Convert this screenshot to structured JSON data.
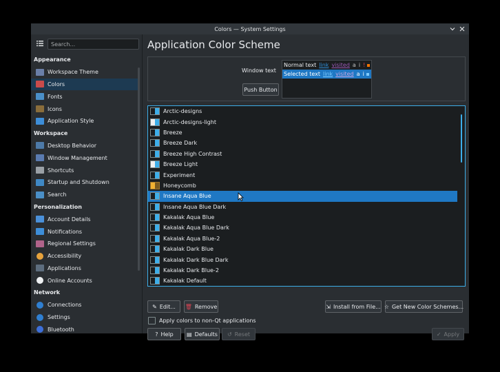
{
  "window": {
    "title": "Colors — System Settings"
  },
  "sidebar": {
    "search_placeholder": "Search...",
    "sections": [
      {
        "header": "Appearance",
        "items": [
          {
            "label": "Workspace Theme",
            "icon": "workspace-theme-icon",
            "color": "#6a7fa8"
          },
          {
            "label": "Colors",
            "icon": "colors-icon",
            "color": "#c94b4b",
            "active": true
          },
          {
            "label": "Fonts",
            "icon": "fonts-icon",
            "color": "#4a8fc7"
          },
          {
            "label": "Icons",
            "icon": "icons-icon",
            "color": "#8a6d3b"
          },
          {
            "label": "Application Style",
            "icon": "app-style-icon",
            "color": "#3d8ed9"
          }
        ]
      },
      {
        "header": "Workspace",
        "items": [
          {
            "label": "Desktop Behavior",
            "icon": "desktop-behavior-icon",
            "color": "#4d7aa8"
          },
          {
            "label": "Window Management",
            "icon": "window-management-icon",
            "color": "#5a7bb0"
          },
          {
            "label": "Shortcuts",
            "icon": "shortcuts-icon",
            "color": "#9aa0a6"
          },
          {
            "label": "Startup and Shutdown",
            "icon": "startup-icon",
            "color": "#3f88c5"
          },
          {
            "label": "Search",
            "icon": "search-icon",
            "color": "#4a8fc7"
          }
        ]
      },
      {
        "header": "Personalization",
        "items": [
          {
            "label": "Account Details",
            "icon": "account-icon",
            "color": "#4a90d9"
          },
          {
            "label": "Notifications",
            "icon": "notifications-icon",
            "color": "#3d8ed9"
          },
          {
            "label": "Regional Settings",
            "icon": "regional-icon",
            "color": "#b0638a"
          },
          {
            "label": "Accessibility",
            "icon": "accessibility-icon",
            "color": "#e6a23c",
            "round": true
          },
          {
            "label": "Applications",
            "icon": "applications-icon",
            "color": "#5d6d7e"
          },
          {
            "label": "Online Accounts",
            "icon": "online-accounts-icon",
            "color": "#eef0f2",
            "round": true
          }
        ]
      },
      {
        "header": "Network",
        "items": [
          {
            "label": "Connections",
            "icon": "connections-icon",
            "color": "#2f7fd1",
            "round": true
          },
          {
            "label": "Settings",
            "icon": "network-settings-icon",
            "color": "#2f7fd1",
            "round": true
          },
          {
            "label": "Bluetooth",
            "icon": "bluetooth-icon",
            "color": "#3d6fd9",
            "round": true
          }
        ]
      }
    ]
  },
  "main": {
    "title": "Application Color Scheme",
    "preview": {
      "window_text_label": "Window text",
      "push_button": "Push Button",
      "normal_row": {
        "text": "Normal text",
        "link": "link",
        "visited": "visited",
        "extra": "a",
        "extra2": "i",
        "extra3": "!"
      },
      "selected_row": {
        "text": "Selected text",
        "link": "link",
        "visited": "visited",
        "extra": "a",
        "extra2": "i"
      }
    },
    "schemes": [
      "Arctic-designs",
      "Arctic-designs-light",
      "Breeze",
      "Breeze Dark",
      "Breeze High Contrast",
      "Breeze Light",
      "Experiment",
      "Honeycomb",
      "Insane Aqua Blue",
      "Insane Aqua Blue Dark",
      "Kakalak Aqua Blue",
      "Kakalak Aqua Blue Dark",
      "Kakalak Aqua Blue-2",
      "Kakalak Dark Blue",
      "Kakalak Dark Blue Dark",
      "Kakalak Dark Blue-2",
      "Kakalak Default"
    ],
    "selected_scheme": "Insane Aqua Blue",
    "buttons": {
      "edit": "Edit...",
      "remove": "Remove",
      "install": "Install from File...",
      "get_new": "Get New Color Schemes..."
    },
    "apply_non_qt_label": "Apply colors to non-Qt applications",
    "footer": {
      "help": "Help",
      "defaults": "Defaults",
      "reset": "Reset",
      "apply": "Apply"
    }
  },
  "colors": {
    "accent": "#3daee9",
    "selection": "#1f78c4",
    "window_bg": "#2a2e32",
    "view_bg": "#1b1e20"
  }
}
